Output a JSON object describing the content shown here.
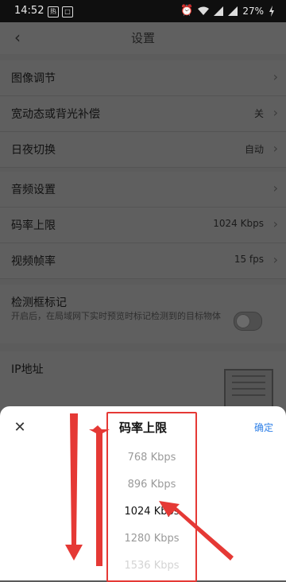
{
  "status": {
    "time": "14:52",
    "box1": "热",
    "box2": "□",
    "battery": "27%"
  },
  "header": {
    "back_icon": "‹",
    "title": "设置"
  },
  "groups": {
    "g1": [
      {
        "label": "图像调节",
        "value": ""
      },
      {
        "label": "宽动态或背光补偿",
        "value": "关"
      },
      {
        "label": "日夜切换",
        "value": "自动"
      }
    ],
    "g2": [
      {
        "label": "音频设置",
        "value": ""
      },
      {
        "label": "码率上限",
        "value": "1024 Kbps"
      },
      {
        "label": "视频帧率",
        "value": "15 fps"
      }
    ],
    "detect": {
      "label": "检测框标记",
      "desc": "开启后，在局域网下实时预览时标记检测到的目标物体"
    },
    "ip": {
      "label": "IP地址"
    }
  },
  "sheet": {
    "close_icon": "✕",
    "title": "码率上限",
    "confirm": "确定",
    "options": [
      "768 Kbps",
      "896 Kbps",
      "1024 Kbps",
      "1280 Kbps",
      "1536 Kbps"
    ],
    "selected_index": 2
  },
  "colors": {
    "accent": "#2d7fe7",
    "annotation": "#e53935"
  }
}
